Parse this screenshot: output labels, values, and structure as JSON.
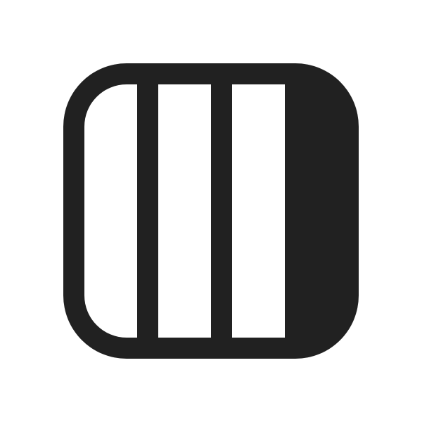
{
  "icon": {
    "name": "column-triple-edit-icon",
    "description_colors": {
      "stroke": "#212121",
      "background": "#ffffff"
    }
  }
}
